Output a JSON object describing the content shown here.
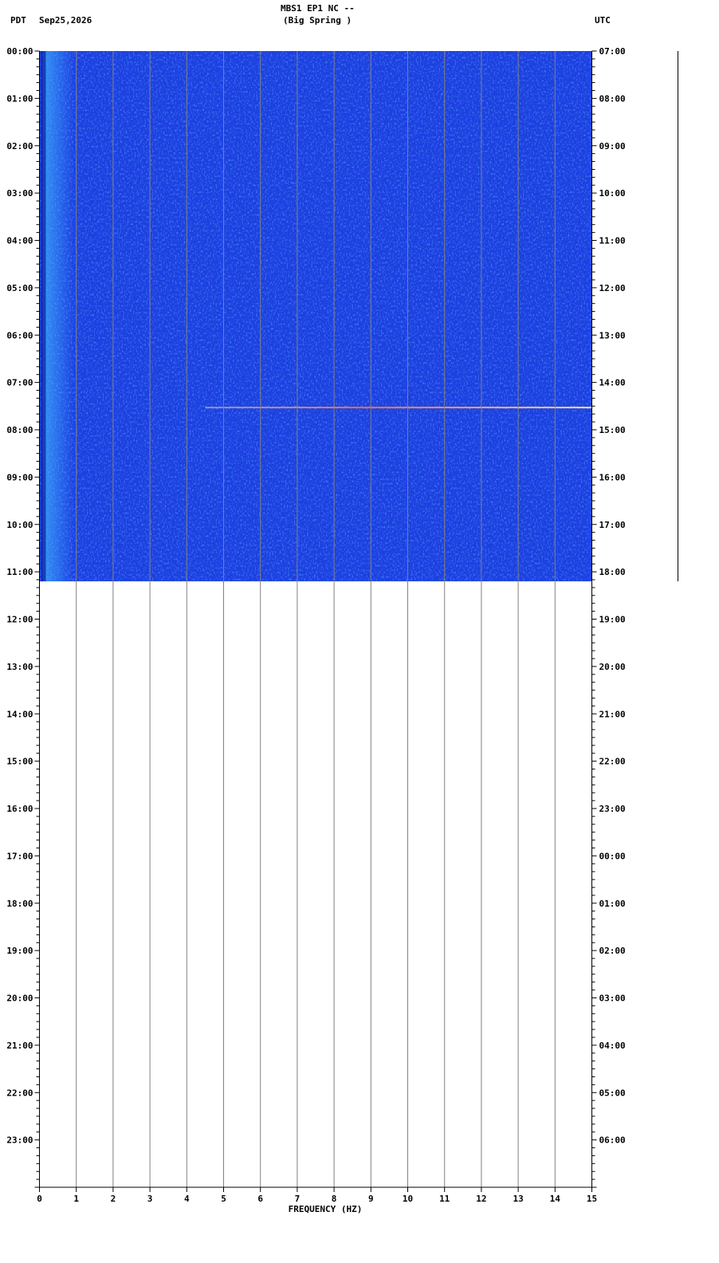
{
  "header": {
    "title": "MBS1 EP1 NC --",
    "subtitle": "(Big Spring )",
    "left_tz": "PDT",
    "date": "Sep25,2026",
    "right_tz": "UTC"
  },
  "chart_data": {
    "type": "heatmap",
    "title": "MBS1 EP1 NC --",
    "subtitle": "(Big Spring )",
    "xlabel": "FREQUENCY (HZ)",
    "xlim": [
      0,
      15
    ],
    "x_ticks": [
      "0",
      "1",
      "2",
      "3",
      "4",
      "5",
      "6",
      "7",
      "8",
      "9",
      "10",
      "11",
      "12",
      "13",
      "14",
      "15"
    ],
    "y_left_ticks": [
      "00:00",
      "01:00",
      "02:00",
      "03:00",
      "04:00",
      "05:00",
      "06:00",
      "07:00",
      "08:00",
      "09:00",
      "10:00",
      "11:00",
      "12:00",
      "13:00",
      "14:00",
      "15:00",
      "16:00",
      "17:00",
      "18:00",
      "19:00",
      "20:00",
      "21:00",
      "22:00",
      "23:00"
    ],
    "y_right_ticks": [
      "07:00",
      "08:00",
      "09:00",
      "10:00",
      "11:00",
      "12:00",
      "13:00",
      "14:00",
      "15:00",
      "16:00",
      "17:00",
      "18:00",
      "19:00",
      "20:00",
      "21:00",
      "22:00",
      "23:00",
      "00:00",
      "01:00",
      "02:00",
      "03:00",
      "04:00",
      "05:00",
      "06:00"
    ],
    "ylim_hours": [
      0,
      24
    ],
    "data_end_hour": 11.1,
    "event": {
      "hour": 7.53,
      "freq_start": 4.5,
      "freq_end": 15
    },
    "colors": {
      "background": "#1d3fe0",
      "noise_light": "#2f8cff",
      "noise_dark": "#1020b0",
      "grid": "#808080",
      "event": "#ff6a3a"
    }
  }
}
